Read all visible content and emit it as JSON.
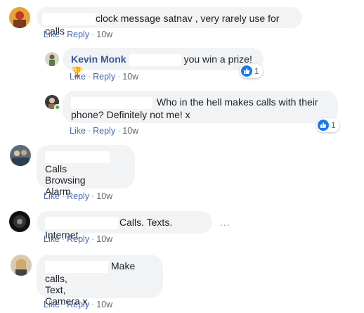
{
  "comments": [
    {
      "text": "clock message satnav , very rarely use for calls",
      "actions": {
        "like": "Like",
        "reply": "Reply",
        "time": "10w"
      }
    },
    {
      "author": "Kevin Monk",
      "text": "you win a prize!",
      "emoji": "🏆",
      "reaction_count": "1",
      "actions": {
        "like": "Like",
        "reply": "Reply",
        "time": "10w"
      }
    },
    {
      "text_line1": "Who in the hell makes calls with their",
      "text_line2": "phone? Definitely not me! x",
      "reaction_count": "1",
      "actions": {
        "like": "Like",
        "reply": "Reply",
        "time": "10w"
      }
    },
    {
      "text_line1": "Calls",
      "text_line2": "Browsing",
      "text_line3": "Alarm",
      "actions": {
        "like": "Like",
        "reply": "Reply",
        "time": "10w"
      }
    },
    {
      "text": "Calls. Texts. Internet.",
      "more": "...",
      "actions": {
        "like": "Like",
        "reply": "Reply",
        "time": "10w"
      }
    },
    {
      "text_line1": "Make calls,",
      "text_line2": "Text,",
      "text_line3": "Camera x",
      "actions": {
        "like": "Like",
        "reply": "Reply",
        "time": "10w"
      }
    }
  ],
  "colors": {
    "bubble": "#f2f3f5",
    "link": "#4267b2",
    "author": "#385898",
    "like_blue": "#1877f2",
    "online": "#42b72a"
  }
}
